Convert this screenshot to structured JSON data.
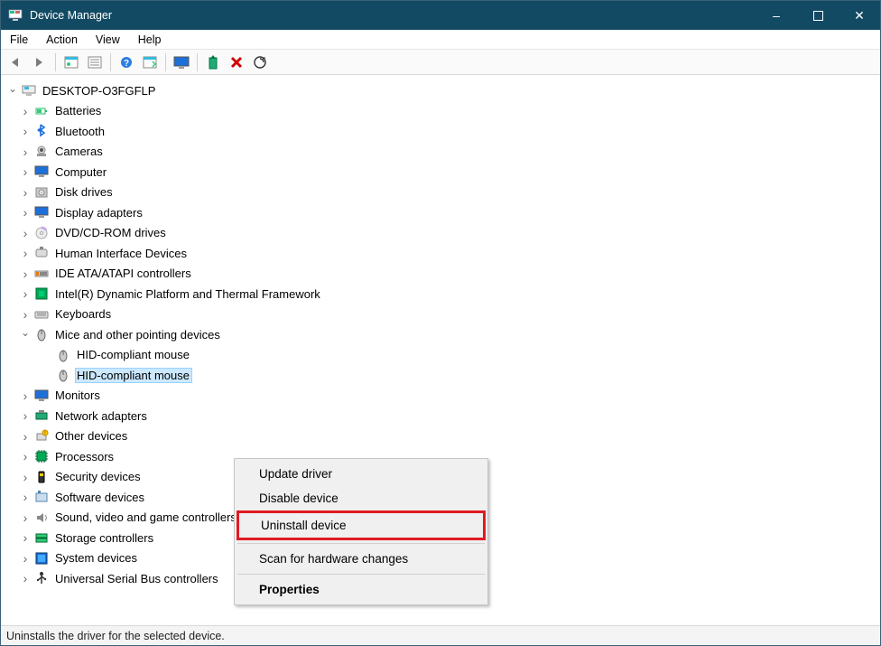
{
  "title": "Device Manager",
  "window_controls": {
    "min": "–",
    "max": "▢",
    "close": "✕"
  },
  "menu": [
    "File",
    "Action",
    "View",
    "Help"
  ],
  "toolbar": {
    "back": "back-icon",
    "forward": "forward-icon",
    "show_hidden": "show-hidden-icon",
    "properties": "properties-icon",
    "help": "help-icon",
    "grid": "view-icon",
    "monitor": "monitor-icon",
    "update": "update-icon",
    "uninstall": "uninstall-icon",
    "scan": "scan-icon"
  },
  "root": "DESKTOP-O3FGFLP",
  "categories": [
    {
      "label": "Batteries",
      "icon": "battery"
    },
    {
      "label": "Bluetooth",
      "icon": "bluetooth"
    },
    {
      "label": "Cameras",
      "icon": "camera"
    },
    {
      "label": "Computer",
      "icon": "computer"
    },
    {
      "label": "Disk drives",
      "icon": "disk"
    },
    {
      "label": "Display adapters",
      "icon": "display"
    },
    {
      "label": "DVD/CD-ROM drives",
      "icon": "dvd"
    },
    {
      "label": "Human Interface Devices",
      "icon": "hid"
    },
    {
      "label": "IDE ATA/ATAPI controllers",
      "icon": "ide"
    },
    {
      "label": "Intel(R) Dynamic Platform and Thermal Framework",
      "icon": "intel"
    },
    {
      "label": "Keyboards",
      "icon": "keyboard"
    },
    {
      "label": "Mice and other pointing devices",
      "icon": "mouse",
      "expanded": true,
      "children": [
        {
          "label": "HID-compliant mouse",
          "icon": "mouse",
          "selected": false
        },
        {
          "label": "HID-compliant mouse",
          "icon": "mouse",
          "selected": true
        }
      ]
    },
    {
      "label": "Monitors",
      "icon": "monitor"
    },
    {
      "label": "Network adapters",
      "icon": "network"
    },
    {
      "label": "Other devices",
      "icon": "other"
    },
    {
      "label": "Processors",
      "icon": "cpu"
    },
    {
      "label": "Security devices",
      "icon": "security"
    },
    {
      "label": "Software devices",
      "icon": "software"
    },
    {
      "label": "Sound, video and game controllers",
      "icon": "sound"
    },
    {
      "label": "Storage controllers",
      "icon": "storage"
    },
    {
      "label": "System devices",
      "icon": "system"
    },
    {
      "label": "Universal Serial Bus controllers",
      "icon": "usb"
    }
  ],
  "context_menu": {
    "update": "Update driver",
    "disable": "Disable device",
    "uninstall": "Uninstall device",
    "scan": "Scan for hardware changes",
    "properties": "Properties"
  },
  "status": "Uninstalls the driver for the selected device.",
  "highlight_item": "uninstall"
}
